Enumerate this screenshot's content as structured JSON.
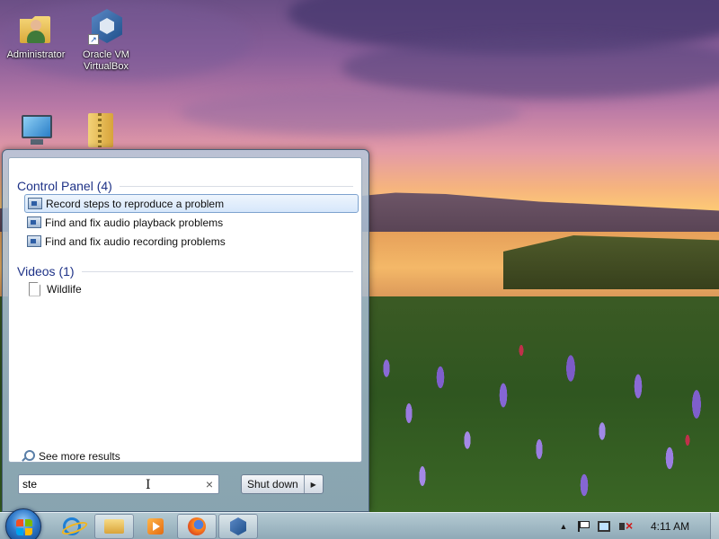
{
  "desktop": {
    "icons": [
      {
        "label": "Administrator",
        "icon": "user-folder-icon"
      },
      {
        "label": "Oracle VM VirtualBox",
        "icon": "virtualbox-icon"
      },
      {
        "label": "",
        "icon": "computer-icon"
      },
      {
        "label": "",
        "icon": "zip-folder-icon"
      }
    ]
  },
  "start_menu": {
    "groups": [
      {
        "title": "Control Panel (4)",
        "items": [
          {
            "label": "Record steps to reproduce a problem",
            "selected": true,
            "icon": "control-panel-icon"
          },
          {
            "label": "Find and fix audio playback problems",
            "selected": false,
            "icon": "control-panel-icon"
          },
          {
            "label": "Find and fix audio recording problems",
            "selected": false,
            "icon": "control-panel-icon"
          }
        ]
      },
      {
        "title": "Videos (1)",
        "items": [
          {
            "label": "Wildlife",
            "selected": false,
            "icon": "file-icon"
          }
        ]
      }
    ],
    "see_more": "See more results",
    "search": {
      "value": "ste",
      "clear_glyph": "×"
    },
    "shutdown": {
      "label": "Shut down",
      "arrow": "▶"
    }
  },
  "taskbar": {
    "apps": [
      {
        "name": "Internet Explorer",
        "icon": "ie-icon",
        "active": false
      },
      {
        "name": "Windows Explorer",
        "icon": "explorer-icon",
        "active": true
      },
      {
        "name": "Windows Media Player",
        "icon": "media-player-icon",
        "active": false
      },
      {
        "name": "Firefox",
        "icon": "firefox-icon",
        "active": true
      },
      {
        "name": "Oracle VM VirtualBox",
        "icon": "virtualbox-icon",
        "active": true
      }
    ],
    "tray": {
      "show_hidden": "▲",
      "clock": "4:11 AM"
    }
  },
  "colors": {
    "group_header": "#1e3287",
    "selection_border": "#7da2ce",
    "taskbar": "#a6bccd"
  }
}
